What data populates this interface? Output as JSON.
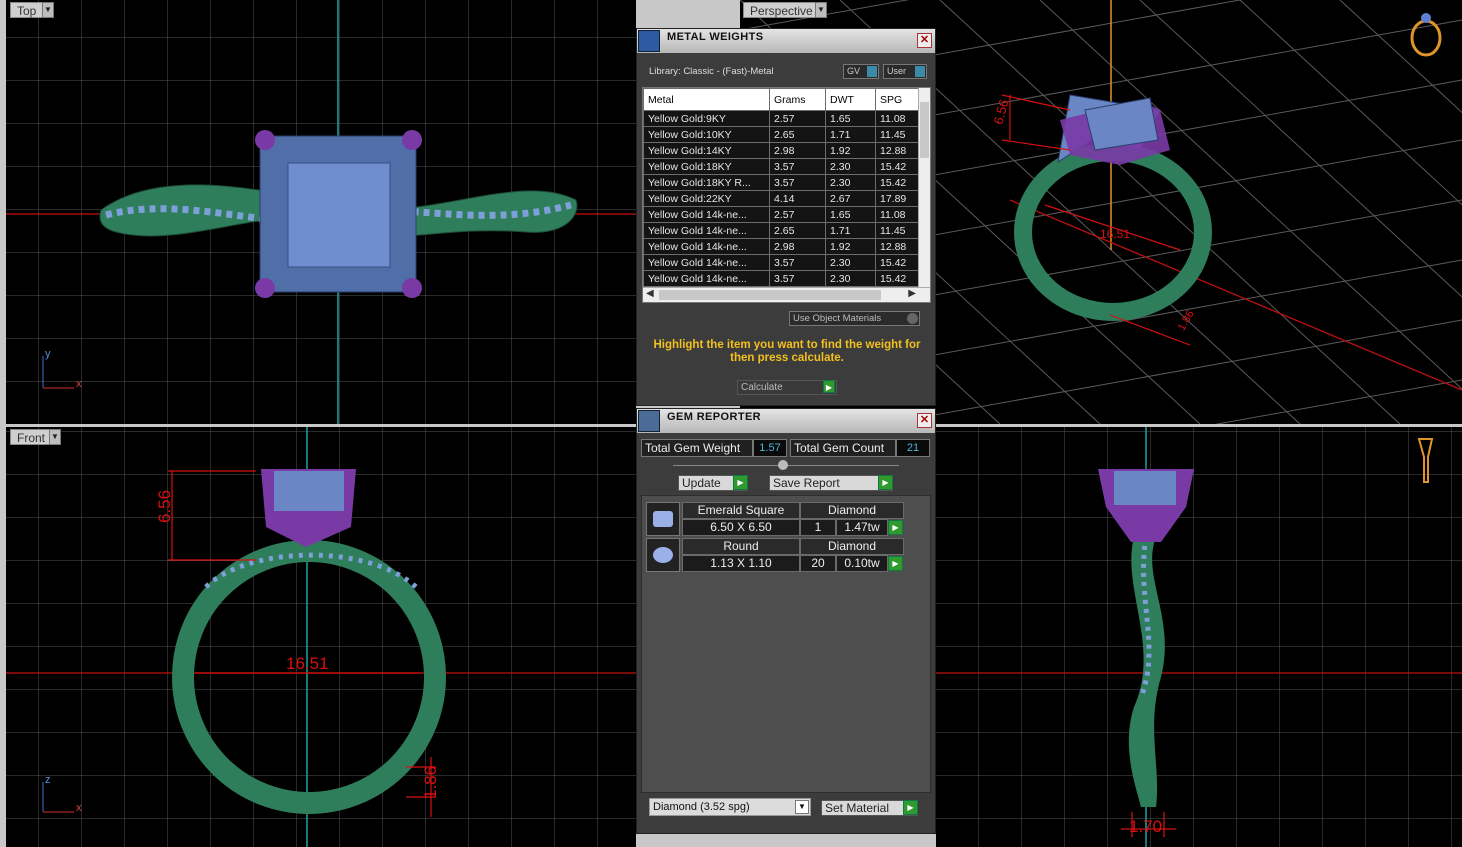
{
  "viewports": {
    "top": {
      "label": "Top"
    },
    "perspective": {
      "label": "Perspective"
    },
    "front": {
      "label": "Front"
    },
    "side": {
      "label": ""
    }
  },
  "axes": {
    "y": "y",
    "x": "x",
    "z": "z"
  },
  "dimensions": {
    "height": "6.56",
    "inner_diameter": "16.51",
    "shank_thickness": "1.86",
    "shank_width": "1.70",
    "persp_diameter": "16.51",
    "persp_height": "6.56",
    "persp_thickness": "1.86"
  },
  "metal_weights": {
    "title": "METAL WEIGHTS",
    "library": "Library: Classic - (Fast)-Metal",
    "gv_toggle": "GV",
    "user_toggle": "User",
    "columns": [
      "Metal",
      "Grams",
      "DWT",
      "SPG"
    ],
    "rows": [
      [
        "Yellow Gold:9KY",
        "2.57",
        "1.65",
        "11.08"
      ],
      [
        "Yellow Gold:10KY",
        "2.65",
        "1.71",
        "11.45"
      ],
      [
        "Yellow Gold:14KY",
        "2.98",
        "1.92",
        "12.88"
      ],
      [
        "Yellow Gold:18KY",
        "3.57",
        "2.30",
        "15.42"
      ],
      [
        "Yellow Gold:18KY R...",
        "3.57",
        "2.30",
        "15.42"
      ],
      [
        "Yellow Gold:22KY",
        "4.14",
        "2.67",
        "17.89"
      ],
      [
        "Yellow Gold 14k-ne...",
        "2.57",
        "1.65",
        "11.08"
      ],
      [
        "Yellow Gold 14k-ne...",
        "2.65",
        "1.71",
        "11.45"
      ],
      [
        "Yellow Gold 14k-ne...",
        "2.98",
        "1.92",
        "12.88"
      ],
      [
        "Yellow Gold 14k-ne...",
        "3.57",
        "2.30",
        "15.42"
      ],
      [
        "Yellow Gold 14k-ne...",
        "3.57",
        "2.30",
        "15.42"
      ]
    ],
    "use_object_materials": "Use Object Materials",
    "hint": "Highlight the item you want to find the weight for then press calculate.",
    "calculate": "Calculate"
  },
  "gem_reporter": {
    "title": "GEM REPORTER",
    "total_weight_label": "Total Gem Weight",
    "total_weight": "1.57",
    "total_count_label": "Total Gem Count",
    "total_count": "21",
    "update": "Update",
    "save_report": "Save Report",
    "gems": [
      {
        "shape": "Emerald Square",
        "material": "Diamond",
        "size": "6.50 X 6.50",
        "count": "1",
        "weight": "1.47tw"
      },
      {
        "shape": "Round",
        "material": "Diamond",
        "size": "1.13 X 1.10",
        "count": "20",
        "weight": "0.10tw"
      }
    ],
    "material_select": "Diamond     (3.52 spg)",
    "set_material": "Set Material"
  },
  "colors": {
    "grid": "#4a4a4a",
    "metal": "#2e7d5b",
    "gem": "#6b86c4",
    "prong": "#7a3aa6",
    "dim": "#e01010"
  }
}
